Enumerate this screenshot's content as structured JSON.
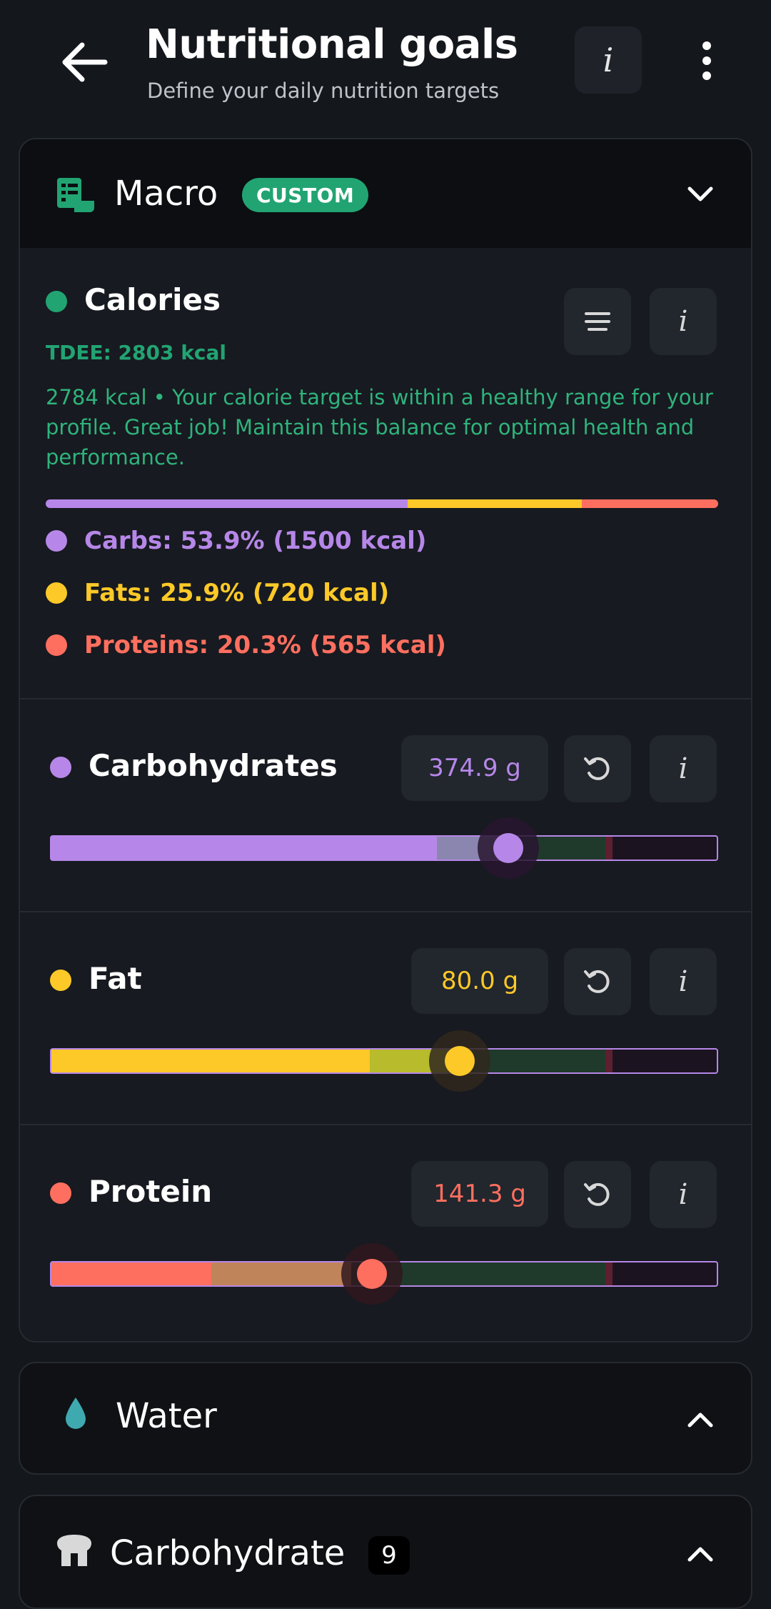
{
  "header": {
    "title": "Nutritional goals",
    "subtitle": "Define your daily nutrition targets",
    "info_label": "i"
  },
  "macro_panel": {
    "title": "Macro",
    "badge": "CUSTOM",
    "icon": "list-icon",
    "calories": {
      "title": "Calories",
      "tdee": "TDEE: 2803 kcal",
      "description": "2784 kcal • Your calorie target is within a healthy range for your profile. Great job! Maintain this balance for optimal health and performance.",
      "split": [
        {
          "label": "Carbs: 53.9% (1500 kcal)",
          "percent": 53.9,
          "color": "#b687e8"
        },
        {
          "label": "Fats: 25.9% (720 kcal)",
          "percent": 25.9,
          "color": "#fcc928"
        },
        {
          "label": "Proteins: 20.3% (565 kcal)",
          "percent": 20.3,
          "color": "#ff6f5f"
        }
      ],
      "info_label": "i"
    },
    "macros": [
      {
        "title": "Carbohydrates",
        "value": "374.9 g",
        "color": "#b687e8",
        "info_label": "i",
        "slider_fraction": 0.685
      },
      {
        "title": "Fat",
        "value": "80.0 g",
        "color": "#fcc928",
        "info_label": "i",
        "slider_fraction": 0.61
      },
      {
        "title": "Protein",
        "value": "141.3 g",
        "color": "#ff6f5f",
        "info_label": "i",
        "slider_fraction": 0.48
      }
    ]
  },
  "water_panel": {
    "title": "Water",
    "icon": "water-drop-icon"
  },
  "carb_panel": {
    "title": "Carbohydrate",
    "count": "9",
    "icon": "bread-icon"
  },
  "colors": {
    "accent_green": "#22a472",
    "carbs": "#b687e8",
    "fats": "#fcc928",
    "proteins": "#ff6f5f"
  }
}
